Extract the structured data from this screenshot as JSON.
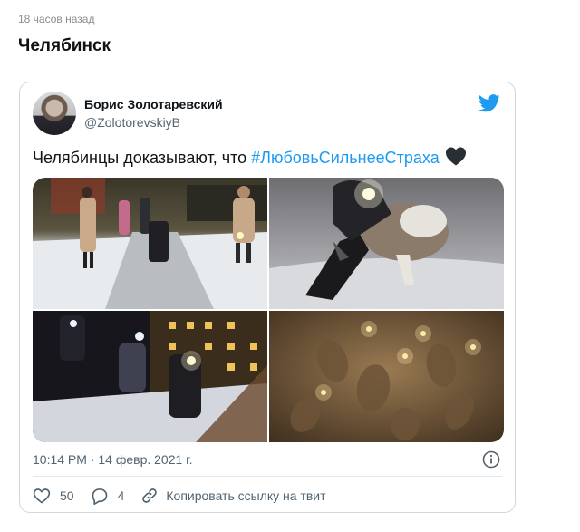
{
  "header": {
    "time_ago": "18 часов назад",
    "title": "Челябинск"
  },
  "tweet": {
    "author_name": "Борис Золотаревский",
    "author_handle": "@ZolotorevskiyB",
    "text_prefix": "Челябинцы доказывают, что ",
    "hashtag": "#ЛюбовьСильнееСтраха",
    "timestamp": "10:14 PM · 14 февр. 2021 г.",
    "likes_count": "50",
    "replies_count": "4",
    "copy_link_label": "Копировать ссылку на твит"
  },
  "icons": {
    "brand": "twitter-bird-icon",
    "emoji": "black-heart-icon",
    "info": "info-icon",
    "like": "heart-outline-icon",
    "reply": "comment-icon",
    "link": "link-icon"
  },
  "colors": {
    "accent": "#1d9bf0",
    "text": "#0f1419",
    "muted": "#536471",
    "border": "#cfd9de"
  },
  "photos": [
    "photo-1",
    "photo-2",
    "photo-3",
    "photo-4"
  ]
}
